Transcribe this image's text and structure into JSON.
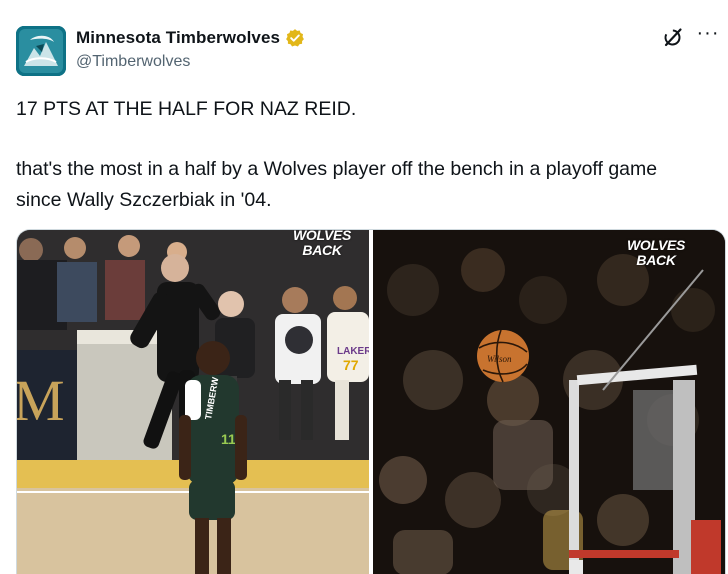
{
  "account": {
    "display_name": "Minnesota Timberwolves",
    "handle": "@Timberwolves",
    "verified": true,
    "verified_color": "#e2b719",
    "avatar_bg": "#0c6b7c"
  },
  "actions": {
    "grok_icon": "grok-icon",
    "more_label": "···"
  },
  "tweet": {
    "line1": "17 PTS AT THE HALF FOR NAZ REID.",
    "line2": "that's the most in a half by a Wolves player off the bench in a playoff game since Wally Szczerbiak in '04."
  },
  "media": {
    "left": {
      "watermark_line1": "WOLVES",
      "watermark_line2": "BACK",
      "jersey_text": "TIMBERW",
      "jersey_number": "11",
      "fan_jersey_text": "LAKER",
      "fan_jersey_number": "77",
      "court_letter": "M"
    },
    "right": {
      "watermark_line1": "WOLVES",
      "watermark_line2": "BACK",
      "ball_text": "Wilson"
    }
  }
}
